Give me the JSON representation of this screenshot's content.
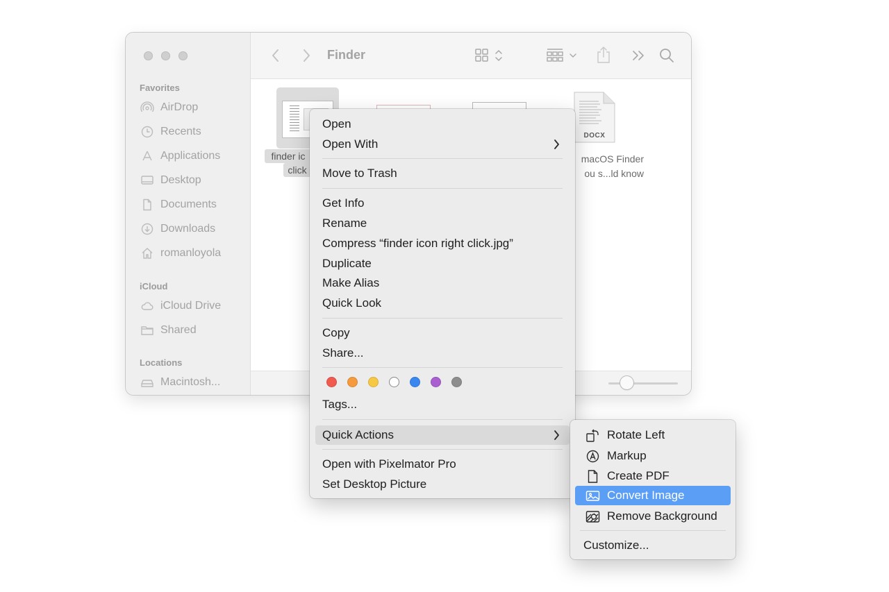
{
  "window": {
    "title": "Finder",
    "sidebar": {
      "favorites_heading": "Favorites",
      "favorites": [
        {
          "label": "AirDrop",
          "icon": "airdrop-icon"
        },
        {
          "label": "Recents",
          "icon": "clock-icon"
        },
        {
          "label": "Applications",
          "icon": "applications-icon"
        },
        {
          "label": "Desktop",
          "icon": "desktop-icon"
        },
        {
          "label": "Documents",
          "icon": "document-icon"
        },
        {
          "label": "Downloads",
          "icon": "download-icon"
        },
        {
          "label": "romanloyola",
          "icon": "home-icon"
        }
      ],
      "icloud_heading": "iCloud",
      "icloud": [
        {
          "label": "iCloud Drive",
          "icon": "cloud-icon"
        },
        {
          "label": "Shared",
          "icon": "shared-folder-icon"
        }
      ],
      "locations_heading": "Locations",
      "locations": [
        {
          "label": "Macintosh...",
          "icon": "disk-icon"
        }
      ]
    },
    "files": [
      {
        "label_line1": "finder ic",
        "label_line2": "click",
        "selected": true
      },
      {
        "label_line1": "",
        "label_line2": ""
      },
      {
        "label_line1": "",
        "label_line2": ""
      },
      {
        "label_line1": "macOS Finder",
        "label_line2": "ou s...ld know",
        "badge": "DOCX"
      }
    ]
  },
  "context_menu": {
    "items": {
      "open": "Open",
      "open_with": "Open With",
      "move_to_trash": "Move to Trash",
      "get_info": "Get Info",
      "rename": "Rename",
      "compress": "Compress “finder icon right click.jpg”",
      "duplicate": "Duplicate",
      "make_alias": "Make Alias",
      "quick_look": "Quick Look",
      "copy": "Copy",
      "share": "Share...",
      "tags": "Tags...",
      "quick_actions": "Quick Actions",
      "open_with_pixelmator": "Open with Pixelmator Pro",
      "set_desktop_picture": "Set Desktop Picture"
    },
    "tag_colors": [
      "#f05a4f",
      "#f59b3d",
      "#f6c844",
      "#ffffff",
      "#3b87f0",
      "#a95fd0",
      "#8e8e8e"
    ]
  },
  "submenu": {
    "items": [
      {
        "label": "Rotate Left",
        "icon": "rotate-left-icon"
      },
      {
        "label": "Markup",
        "icon": "markup-icon"
      },
      {
        "label": "Create PDF",
        "icon": "pdf-icon"
      },
      {
        "label": "Convert Image",
        "icon": "convert-image-icon",
        "selected": true
      },
      {
        "label": "Remove Background",
        "icon": "remove-background-icon"
      }
    ],
    "customize": "Customize..."
  },
  "colors": {
    "selection_blue": "#5b9ef5",
    "menu_bg": "#ececec",
    "sidebar_text": "#a3a3a3"
  }
}
